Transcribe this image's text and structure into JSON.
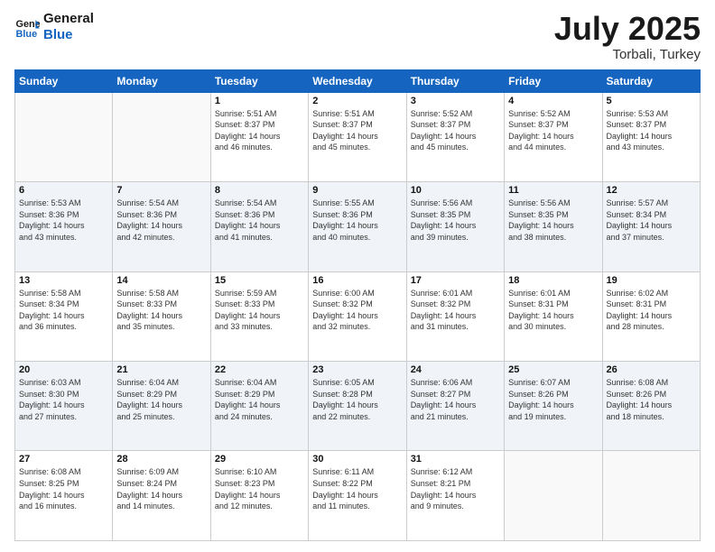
{
  "header": {
    "logo_line1": "General",
    "logo_line2": "Blue",
    "title": "July 2025",
    "subtitle": "Torbali, Turkey"
  },
  "weekdays": [
    "Sunday",
    "Monday",
    "Tuesday",
    "Wednesday",
    "Thursday",
    "Friday",
    "Saturday"
  ],
  "weeks": [
    [
      {
        "day": "",
        "content": ""
      },
      {
        "day": "",
        "content": ""
      },
      {
        "day": "1",
        "content": "Sunrise: 5:51 AM\nSunset: 8:37 PM\nDaylight: 14 hours\nand 46 minutes."
      },
      {
        "day": "2",
        "content": "Sunrise: 5:51 AM\nSunset: 8:37 PM\nDaylight: 14 hours\nand 45 minutes."
      },
      {
        "day": "3",
        "content": "Sunrise: 5:52 AM\nSunset: 8:37 PM\nDaylight: 14 hours\nand 45 minutes."
      },
      {
        "day": "4",
        "content": "Sunrise: 5:52 AM\nSunset: 8:37 PM\nDaylight: 14 hours\nand 44 minutes."
      },
      {
        "day": "5",
        "content": "Sunrise: 5:53 AM\nSunset: 8:37 PM\nDaylight: 14 hours\nand 43 minutes."
      }
    ],
    [
      {
        "day": "6",
        "content": "Sunrise: 5:53 AM\nSunset: 8:36 PM\nDaylight: 14 hours\nand 43 minutes."
      },
      {
        "day": "7",
        "content": "Sunrise: 5:54 AM\nSunset: 8:36 PM\nDaylight: 14 hours\nand 42 minutes."
      },
      {
        "day": "8",
        "content": "Sunrise: 5:54 AM\nSunset: 8:36 PM\nDaylight: 14 hours\nand 41 minutes."
      },
      {
        "day": "9",
        "content": "Sunrise: 5:55 AM\nSunset: 8:36 PM\nDaylight: 14 hours\nand 40 minutes."
      },
      {
        "day": "10",
        "content": "Sunrise: 5:56 AM\nSunset: 8:35 PM\nDaylight: 14 hours\nand 39 minutes."
      },
      {
        "day": "11",
        "content": "Sunrise: 5:56 AM\nSunset: 8:35 PM\nDaylight: 14 hours\nand 38 minutes."
      },
      {
        "day": "12",
        "content": "Sunrise: 5:57 AM\nSunset: 8:34 PM\nDaylight: 14 hours\nand 37 minutes."
      }
    ],
    [
      {
        "day": "13",
        "content": "Sunrise: 5:58 AM\nSunset: 8:34 PM\nDaylight: 14 hours\nand 36 minutes."
      },
      {
        "day": "14",
        "content": "Sunrise: 5:58 AM\nSunset: 8:33 PM\nDaylight: 14 hours\nand 35 minutes."
      },
      {
        "day": "15",
        "content": "Sunrise: 5:59 AM\nSunset: 8:33 PM\nDaylight: 14 hours\nand 33 minutes."
      },
      {
        "day": "16",
        "content": "Sunrise: 6:00 AM\nSunset: 8:32 PM\nDaylight: 14 hours\nand 32 minutes."
      },
      {
        "day": "17",
        "content": "Sunrise: 6:01 AM\nSunset: 8:32 PM\nDaylight: 14 hours\nand 31 minutes."
      },
      {
        "day": "18",
        "content": "Sunrise: 6:01 AM\nSunset: 8:31 PM\nDaylight: 14 hours\nand 30 minutes."
      },
      {
        "day": "19",
        "content": "Sunrise: 6:02 AM\nSunset: 8:31 PM\nDaylight: 14 hours\nand 28 minutes."
      }
    ],
    [
      {
        "day": "20",
        "content": "Sunrise: 6:03 AM\nSunset: 8:30 PM\nDaylight: 14 hours\nand 27 minutes."
      },
      {
        "day": "21",
        "content": "Sunrise: 6:04 AM\nSunset: 8:29 PM\nDaylight: 14 hours\nand 25 minutes."
      },
      {
        "day": "22",
        "content": "Sunrise: 6:04 AM\nSunset: 8:29 PM\nDaylight: 14 hours\nand 24 minutes."
      },
      {
        "day": "23",
        "content": "Sunrise: 6:05 AM\nSunset: 8:28 PM\nDaylight: 14 hours\nand 22 minutes."
      },
      {
        "day": "24",
        "content": "Sunrise: 6:06 AM\nSunset: 8:27 PM\nDaylight: 14 hours\nand 21 minutes."
      },
      {
        "day": "25",
        "content": "Sunrise: 6:07 AM\nSunset: 8:26 PM\nDaylight: 14 hours\nand 19 minutes."
      },
      {
        "day": "26",
        "content": "Sunrise: 6:08 AM\nSunset: 8:26 PM\nDaylight: 14 hours\nand 18 minutes."
      }
    ],
    [
      {
        "day": "27",
        "content": "Sunrise: 6:08 AM\nSunset: 8:25 PM\nDaylight: 14 hours\nand 16 minutes."
      },
      {
        "day": "28",
        "content": "Sunrise: 6:09 AM\nSunset: 8:24 PM\nDaylight: 14 hours\nand 14 minutes."
      },
      {
        "day": "29",
        "content": "Sunrise: 6:10 AM\nSunset: 8:23 PM\nDaylight: 14 hours\nand 12 minutes."
      },
      {
        "day": "30",
        "content": "Sunrise: 6:11 AM\nSunset: 8:22 PM\nDaylight: 14 hours\nand 11 minutes."
      },
      {
        "day": "31",
        "content": "Sunrise: 6:12 AM\nSunset: 8:21 PM\nDaylight: 14 hours\nand 9 minutes."
      },
      {
        "day": "",
        "content": ""
      },
      {
        "day": "",
        "content": ""
      }
    ]
  ]
}
